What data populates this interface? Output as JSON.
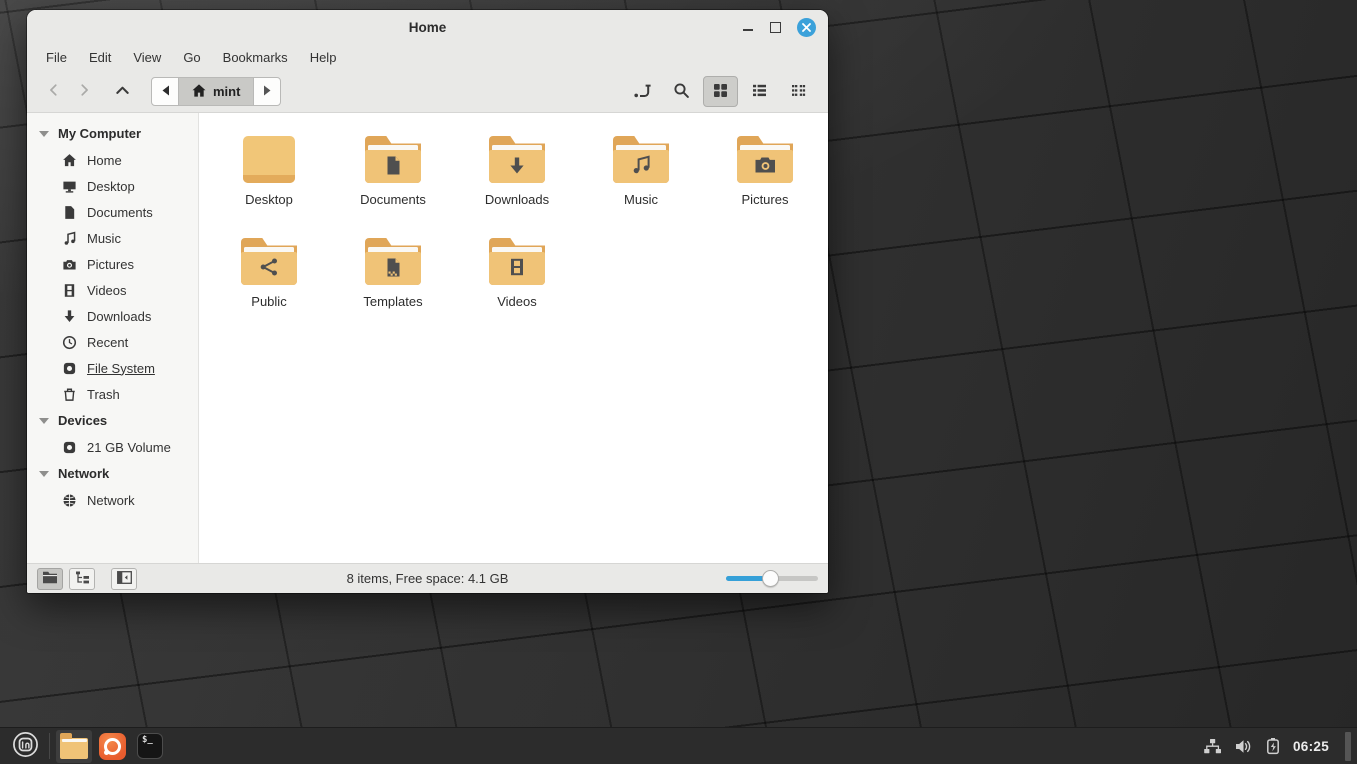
{
  "window": {
    "title": "Home",
    "menubar": [
      "File",
      "Edit",
      "View",
      "Go",
      "Bookmarks",
      "Help"
    ],
    "breadcrumb": {
      "current": "mint"
    },
    "sidebar": {
      "sections": [
        {
          "label": "My Computer",
          "items": [
            {
              "label": "Home",
              "icon": "home-icon"
            },
            {
              "label": "Desktop",
              "icon": "monitor-icon"
            },
            {
              "label": "Documents",
              "icon": "document-icon"
            },
            {
              "label": "Music",
              "icon": "music-note-icon"
            },
            {
              "label": "Pictures",
              "icon": "camera-icon"
            },
            {
              "label": "Videos",
              "icon": "film-icon"
            },
            {
              "label": "Downloads",
              "icon": "download-arrow-icon"
            },
            {
              "label": "Recent",
              "icon": "clock-icon"
            },
            {
              "label": "File System",
              "icon": "drive-icon"
            },
            {
              "label": "Trash",
              "icon": "trash-icon"
            }
          ]
        },
        {
          "label": "Devices",
          "items": [
            {
              "label": "21 GB Volume",
              "icon": "drive-icon"
            }
          ]
        },
        {
          "label": "Network",
          "items": [
            {
              "label": "Network",
              "icon": "globe-icon"
            }
          ]
        }
      ]
    },
    "files": [
      {
        "label": "Desktop",
        "icon": "desktop-folder-icon"
      },
      {
        "label": "Documents",
        "icon": "folder-document-icon"
      },
      {
        "label": "Downloads",
        "icon": "folder-download-icon"
      },
      {
        "label": "Music",
        "icon": "folder-music-icon"
      },
      {
        "label": "Pictures",
        "icon": "folder-camera-icon"
      },
      {
        "label": "Public",
        "icon": "folder-share-icon"
      },
      {
        "label": "Templates",
        "icon": "folder-template-icon"
      },
      {
        "label": "Videos",
        "icon": "folder-film-icon"
      }
    ],
    "statusbar": {
      "summary": "8 items, Free space: 4.1 GB"
    }
  },
  "taskbar": {
    "clock": "06:25"
  },
  "colors": {
    "accent": "#3ba1da",
    "folder_body": "#f0c377",
    "folder_tab": "#e0a658",
    "titlebar_bg": "#e9e9e7",
    "taskbar_bg": "#2c2c2c"
  }
}
